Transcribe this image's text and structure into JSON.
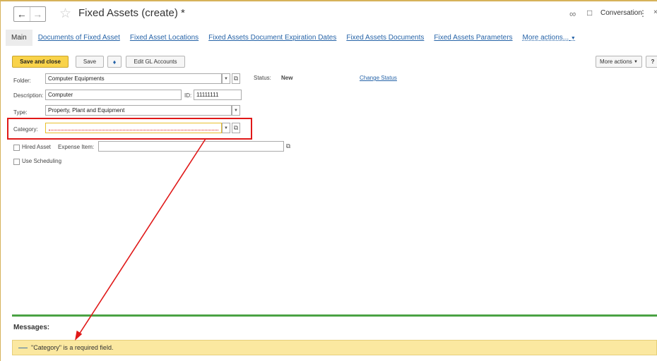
{
  "window": {
    "title": "Fixed Assets (create) *",
    "conversation_label": "Conversation"
  },
  "tabs": [
    {
      "label": "Main"
    },
    {
      "label": "Documents of Fixed Asset"
    },
    {
      "label": "Fixed Asset Locations"
    },
    {
      "label": "Fixed Assets Document Expiration Dates"
    },
    {
      "label": "Fixed Assets Documents"
    },
    {
      "label": "Fixed Assets Parameters"
    },
    {
      "label": "More actions..."
    }
  ],
  "toolbar": {
    "save_close": "Save and close",
    "save": "Save",
    "edit_gl": "Edit GL Accounts",
    "more_actions": "More actions",
    "help": "?"
  },
  "form": {
    "folder_label": "Folder:",
    "folder_value": "Computer Equipments",
    "status_label": "Status:",
    "status_value": "New",
    "change_status": "Change Status",
    "description_label": "Description:",
    "description_value": "Computer",
    "id_label": "ID:",
    "id_value": "11111111",
    "type_label": "Type:",
    "type_value": "Property, Plant and Equipment",
    "category_label": "Category:",
    "category_value": "",
    "hired_asset_label": "Hired Asset",
    "expense_item_label": "Expense Item:",
    "expense_item_value": "",
    "use_scheduling_label": "Use Scheduling"
  },
  "messages": {
    "title": "Messages:",
    "items": [
      "\"Category\" is a required field."
    ]
  },
  "colors": {
    "accent_link": "#2764a8",
    "primary_button": "#f9d34a",
    "annotation": "#e01818",
    "message_bg": "#fbe8a0",
    "separator": "#4aa244"
  }
}
